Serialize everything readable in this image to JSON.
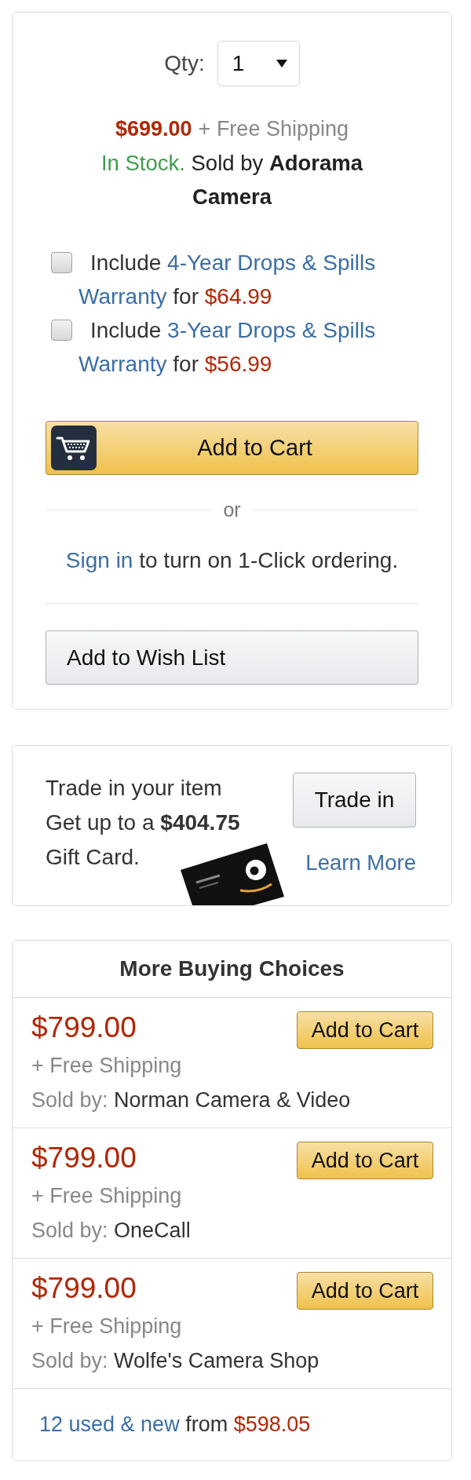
{
  "purchase_box": {
    "quantity": {
      "label": "Qty:",
      "value": "1"
    },
    "price": "$699.00",
    "shipping": "+ Free Shipping",
    "availability": {
      "status": "In Stock.",
      "seller_text": "Sold by **Adorama Camera**"
    },
    "warranty_options": [
      {
        "checked": false,
        "text": "Include",
        "link_lines": [
          "4-Year Drops & Spills",
          "Warranty"
        ],
        "suffix": "for",
        "price": "$64.99"
      },
      {
        "checked": false,
        "text": "Include",
        "link_lines": [
          "3-Year Drops & Spills",
          "Warranty"
        ],
        "suffix": "for",
        "price": "$56.99"
      }
    ],
    "add_to_cart_button": "Add to Cart",
    "separator": "or",
    "sign_in": {
      "link": "Sign in",
      "text": "to turn on 1-Click ordering."
    },
    "wish_list_button": "Add to Wish List"
  },
  "trade_in": {
    "lines": [
      "Trade in your item",
      "Get up to a **$404.75**",
      "Gift Card."
    ],
    "button": "Trade in",
    "link": "Learn More"
  },
  "more_buying_choices": {
    "title": "More Buying Choices",
    "offers": [
      {
        "price": "$799.00",
        "shipping": "+ Free Shipping",
        "seller_label": "Sold by:",
        "seller": "Norman Camera & Video",
        "button": "Add to Cart"
      },
      {
        "price": "$799.00",
        "shipping": "+ Free Shipping",
        "seller_label": "Sold by:",
        "seller": "OneCall",
        "button": "Add to Cart"
      },
      {
        "price": "$799.00",
        "shipping": "+ Free Shipping",
        "seller_label": "Sold by:",
        "seller": "Wolfe's Camera Shop",
        "button": "Add to Cart"
      }
    ],
    "footer": {
      "link": "12 used & new",
      "text": "from",
      "price": "$598.05"
    }
  }
}
